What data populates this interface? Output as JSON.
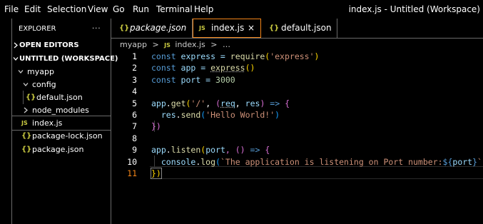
{
  "menubar": {
    "items": [
      "File",
      "Edit",
      "Selection",
      "View",
      "Go",
      "Run",
      "Terminal",
      "Help"
    ],
    "window_title": "index.js - Untitled (Workspace)"
  },
  "sidebar": {
    "title": "EXPLORER",
    "more_label": "···",
    "open_editors": "OPEN EDITORS",
    "workspace": "UNTITLED (WORKSPACE)",
    "tree": [
      {
        "label": "myapp",
        "kind": "folder",
        "expanded": true
      },
      {
        "label": "config",
        "kind": "folder",
        "expanded": true
      },
      {
        "label": "default.json",
        "kind": "json"
      },
      {
        "label": "node_modules",
        "kind": "folder",
        "expanded": false
      },
      {
        "label": "index.js",
        "kind": "js",
        "selected": true
      },
      {
        "label": "package-lock.json",
        "kind": "json"
      },
      {
        "label": "package.json",
        "kind": "json"
      }
    ]
  },
  "tabs": [
    {
      "label": "package.json",
      "icon": "{}",
      "italic": true,
      "active": false
    },
    {
      "label": "index.js",
      "icon": "JS",
      "active": true,
      "close": "×"
    },
    {
      "label": "default.json",
      "icon": "{}",
      "active": false
    }
  ],
  "breadcrumb": {
    "folder": "myapp",
    "sep": ">",
    "file_icon": "JS",
    "file": "index.js",
    "ellipsis": "…"
  },
  "editor": {
    "line_numbers": [
      "1",
      "2",
      "3",
      "4",
      "5",
      "6",
      "7",
      "8",
      "9",
      "10",
      "11"
    ],
    "current_line": 11,
    "lines": {
      "l1": [
        "const",
        " express = ",
        "require",
        "(",
        "'express'",
        ")"
      ],
      "l2": [
        "const",
        " app = ",
        "express",
        "()"
      ],
      "l3": [
        "const",
        " port = ",
        "3000"
      ],
      "l5": [
        "app",
        ".",
        "get",
        "(",
        "'/'",
        ", ",
        "(",
        "req",
        ", ",
        "res",
        ") ",
        "=>",
        " {"
      ],
      "l6": [
        "  res",
        ".",
        "send",
        "(",
        "'Hello World!'",
        ")"
      ],
      "l7": [
        "})"
      ],
      "l9": [
        "app",
        ".",
        "listen",
        "(",
        "port",
        ", () ",
        "=>",
        " {"
      ],
      "l10": [
        "  console",
        ".",
        "log",
        "(",
        "`The application is listening on Port number:",
        "${",
        "port",
        "}",
        "`",
        ")"
      ],
      "l11": [
        "})"
      ]
    }
  },
  "colors": {
    "accent": "#f38518",
    "keyword": "#569cd6",
    "string": "#ce9178",
    "function": "#dcdcaa",
    "variable": "#9cdcfe",
    "number": "#b5cea8",
    "icon_yellow": "#cbcb41"
  }
}
